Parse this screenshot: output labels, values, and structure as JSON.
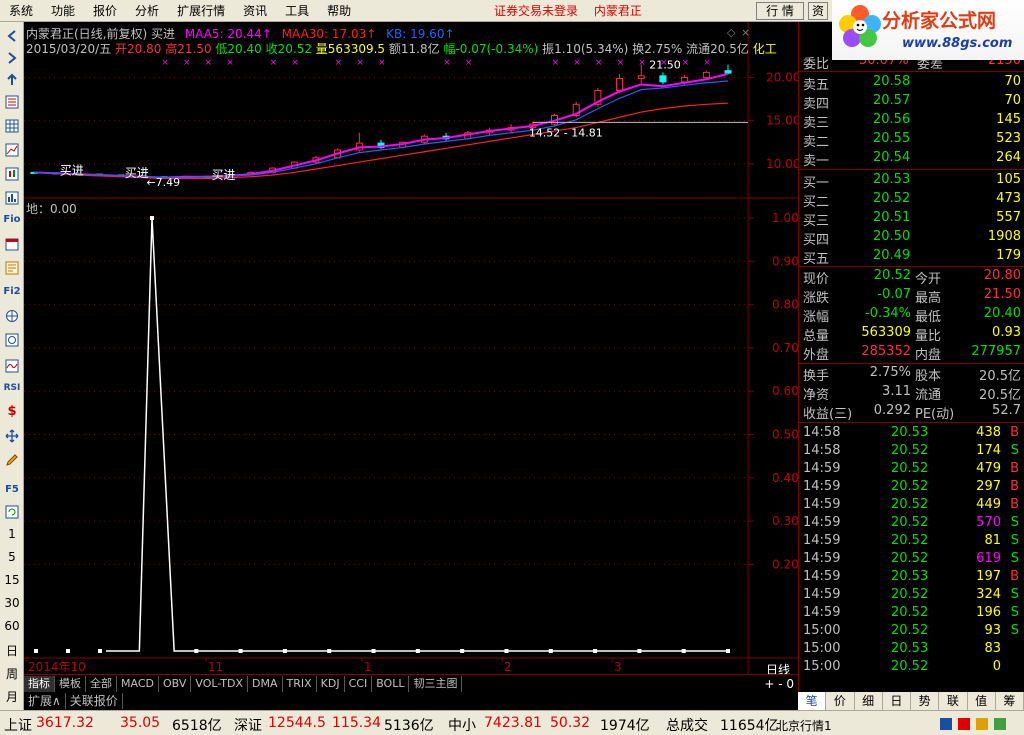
{
  "menu": {
    "items": [
      "系统",
      "功能",
      "报价",
      "分析",
      "扩展行情",
      "资讯",
      "工具",
      "帮助"
    ],
    "status_msg": "证券交易未登录",
    "stock_name": "内蒙君正",
    "btn_hangqing": "行 情",
    "btn_zi": "资"
  },
  "logo": {
    "title": "分析家公式网",
    "url": "www.88gs.com"
  },
  "chart_header": {
    "line1_title": "内蒙君正(日线,前复权) 买进",
    "ma5": "MAA5: 20.44↑",
    "ma30": "MAA30: 17.03↑",
    "kb": "KB: 19.60↑",
    "line2_date": "2015/03/20/五",
    "open": "开20.80",
    "high": "高21.50",
    "low": "低20.40",
    "close": "收20.52",
    "vol": "量563309.5",
    "amount": "额11.8亿",
    "change": "幅-0.07(-0.34%)",
    "amp": "振1.10(5.34%)",
    "turnover": "换2.75%",
    "float_cap": "流通20.5亿",
    "industry": "化工",
    "lower_title": "地：0.00"
  },
  "left_toolbar": {
    "labels": [
      "Fio",
      "Fi2",
      "RSI",
      "F5"
    ],
    "periods": [
      "1",
      "5",
      "15",
      "30",
      "60",
      "日",
      "周",
      "月"
    ]
  },
  "chart_tabs": {
    "items": [
      "指标",
      "模板",
      "全部",
      "MACD",
      "OBV",
      "VOL-TDX",
      "DMA",
      "TRIX",
      "KDJ",
      "CCI",
      "BOLL",
      "韧三主图"
    ],
    "right": "+ - 0",
    "period_label": "日线"
  },
  "ext_tabs": [
    "扩展∧",
    "关联报价"
  ],
  "chart_data": [
    {
      "type": "candlestick",
      "title": "",
      "y_ticks": [
        "20.00",
        "15.00",
        "10.00"
      ],
      "ylim": [
        6.5,
        22.5
      ],
      "annotations": [
        "买进",
        "买进",
        "买进",
        "7.49",
        "21.50",
        "14.52 - 14.81"
      ],
      "series": [
        {
          "name": "MAA5",
          "color": "#ff00ff",
          "values": [
            9.0,
            8.9,
            8.8,
            8.7,
            8.6,
            8.5,
            8.4,
            8.5,
            8.5,
            8.6,
            8.8,
            9.2,
            9.8,
            10.4,
            11.2,
            11.9,
            12.0,
            12.3,
            12.8,
            13.0,
            13.4,
            13.8,
            14.1,
            14.4,
            15.0,
            15.8,
            17.2,
            18.4,
            19.2,
            19.0,
            19.4,
            19.8,
            20.44
          ]
        },
        {
          "name": "MAA30",
          "color": "#ff2020",
          "values": [
            9.0,
            8.9,
            8.7,
            8.6,
            8.5,
            8.4,
            8.3,
            8.3,
            8.3,
            8.4,
            8.5,
            8.7,
            9.0,
            9.4,
            9.8,
            10.2,
            10.6,
            11.0,
            11.4,
            11.8,
            12.2,
            12.6,
            13.0,
            13.4,
            13.8,
            14.2,
            14.8,
            15.4,
            16.0,
            16.4,
            16.7,
            16.9,
            17.03
          ]
        },
        {
          "name": "KB",
          "color": "#1e64ff",
          "values": [
            9.0,
            8.9,
            8.8,
            8.7,
            8.6,
            8.5,
            8.4,
            8.4,
            8.5,
            8.6,
            8.7,
            9.0,
            9.5,
            10.0,
            10.7,
            11.3,
            11.6,
            11.9,
            12.3,
            12.6,
            12.9,
            13.3,
            13.6,
            13.9,
            14.4,
            15.1,
            16.4,
            17.6,
            18.6,
            18.8,
            19.1,
            19.4,
            19.6
          ]
        }
      ],
      "candles": [
        [
          9.0,
          9.1,
          8.9,
          8.95
        ],
        [
          8.95,
          9.0,
          8.85,
          8.9
        ],
        [
          8.9,
          8.95,
          8.75,
          8.8
        ],
        [
          8.8,
          8.85,
          8.65,
          8.7
        ],
        [
          8.7,
          8.75,
          8.55,
          8.6
        ],
        [
          8.6,
          8.7,
          8.45,
          8.5
        ],
        [
          8.5,
          8.55,
          8.3,
          8.4
        ],
        [
          8.4,
          8.6,
          8.35,
          8.55
        ],
        [
          8.55,
          8.6,
          8.45,
          8.5
        ],
        [
          8.5,
          8.8,
          8.45,
          8.7
        ],
        [
          8.7,
          9.1,
          8.65,
          9.0
        ],
        [
          9.0,
          9.6,
          8.95,
          9.5
        ],
        [
          9.5,
          10.3,
          9.4,
          10.2
        ],
        [
          10.2,
          10.9,
          10.0,
          10.7
        ],
        [
          10.7,
          11.8,
          10.6,
          11.6
        ],
        [
          11.6,
          13.6,
          11.4,
          12.4
        ],
        [
          12.4,
          12.8,
          11.7,
          11.9
        ],
        [
          11.9,
          12.6,
          11.8,
          12.5
        ],
        [
          12.5,
          13.4,
          12.3,
          13.2
        ],
        [
          13.2,
          13.6,
          12.7,
          12.9
        ],
        [
          12.9,
          13.8,
          12.8,
          13.6
        ],
        [
          13.6,
          14.2,
          13.2,
          13.9
        ],
        [
          13.9,
          14.6,
          13.5,
          14.2
        ],
        [
          14.2,
          14.9,
          13.8,
          14.6
        ],
        [
          14.6,
          15.8,
          14.4,
          15.6
        ],
        [
          15.6,
          17.2,
          15.4,
          16.9
        ],
        [
          16.9,
          18.8,
          16.6,
          18.5
        ],
        [
          18.5,
          20.4,
          18.2,
          19.9
        ],
        [
          19.9,
          21.5,
          19.3,
          20.2
        ],
        [
          20.2,
          20.6,
          19.2,
          19.5
        ],
        [
          19.5,
          20.3,
          19.1,
          20.0
        ],
        [
          20.0,
          20.8,
          19.7,
          20.6
        ],
        [
          20.8,
          21.5,
          20.4,
          20.52
        ]
      ]
    },
    {
      "type": "line",
      "title": "地：0.00",
      "y_ticks": [
        "1.00",
        "0.90",
        "0.80",
        "0.70",
        "0.60",
        "0.50",
        "0.40",
        "0.30",
        "0.20"
      ],
      "ylim": [
        0,
        1
      ],
      "x_ticks": [
        "2014年10",
        "11",
        "1",
        "2",
        "3"
      ],
      "values": [
        0,
        0,
        0,
        0,
        0,
        0,
        1.0,
        0,
        0,
        0,
        0,
        0,
        0,
        0,
        0,
        0,
        0,
        0,
        0,
        0,
        0,
        0,
        0,
        0,
        0,
        0,
        0,
        0,
        0,
        0,
        0,
        0,
        0
      ]
    }
  ],
  "order_book": {
    "wei_bi_label": "委比",
    "wei_bi": "50.07%",
    "wei_cha_label": "委差",
    "wei_cha": "2150",
    "sell": [
      {
        "label": "卖五",
        "price": "20.58",
        "vol": "70"
      },
      {
        "label": "卖四",
        "price": "20.57",
        "vol": "70"
      },
      {
        "label": "卖三",
        "price": "20.56",
        "vol": "145"
      },
      {
        "label": "卖二",
        "price": "20.55",
        "vol": "523"
      },
      {
        "label": "卖一",
        "price": "20.54",
        "vol": "264"
      }
    ],
    "buy": [
      {
        "label": "买一",
        "price": "20.53",
        "vol": "105"
      },
      {
        "label": "买二",
        "price": "20.52",
        "vol": "473"
      },
      {
        "label": "买三",
        "price": "20.51",
        "vol": "557"
      },
      {
        "label": "买四",
        "price": "20.50",
        "vol": "1908"
      },
      {
        "label": "买五",
        "price": "20.49",
        "vol": "179"
      }
    ]
  },
  "quote": [
    {
      "l1": "现价",
      "v1": "20.52",
      "l2": "今开",
      "v2": "20.80"
    },
    {
      "l1": "涨跌",
      "v1": "-0.07",
      "l2": "最高",
      "v2": "21.50"
    },
    {
      "l1": "涨幅",
      "v1": "-0.34%",
      "l2": "最低",
      "v2": "20.40"
    },
    {
      "l1": "总量",
      "v1": "563309",
      "l2": "量比",
      "v2": "0.93"
    },
    {
      "l1": "外盘",
      "v1": "285352",
      "l2": "内盘",
      "v2": "277957"
    }
  ],
  "fundamentals": [
    {
      "l1": "换手",
      "v1": "2.75%",
      "l2": "股本",
      "v2": "20.5亿"
    },
    {
      "l1": "净资",
      "v1": "3.11",
      "l2": "流通",
      "v2": "20.5亿"
    },
    {
      "l1": "收益(三)",
      "v1": "0.292",
      "l2": "PE(动)",
      "v2": "52.7"
    }
  ],
  "ticks": [
    {
      "time": "14:58",
      "price": "20.53",
      "vol": "438",
      "side": "B"
    },
    {
      "time": "14:58",
      "price": "20.52",
      "vol": "174",
      "side": "S"
    },
    {
      "time": "14:59",
      "price": "20.52",
      "vol": "479",
      "side": "B"
    },
    {
      "time": "14:59",
      "price": "20.52",
      "vol": "297",
      "side": "B"
    },
    {
      "time": "14:59",
      "price": "20.52",
      "vol": "449",
      "side": "B"
    },
    {
      "time": "14:59",
      "price": "20.52",
      "vol": "570",
      "side": "S"
    },
    {
      "time": "14:59",
      "price": "20.52",
      "vol": "81",
      "side": "S"
    },
    {
      "time": "14:59",
      "price": "20.52",
      "vol": "619",
      "side": "S"
    },
    {
      "time": "14:59",
      "price": "20.53",
      "vol": "197",
      "side": "B"
    },
    {
      "time": "14:59",
      "price": "20.52",
      "vol": "324",
      "side": "S"
    },
    {
      "time": "14:59",
      "price": "20.52",
      "vol": "196",
      "side": "S"
    },
    {
      "time": "15:00",
      "price": "20.52",
      "vol": "93",
      "side": "S"
    },
    {
      "time": "15:00",
      "price": "20.53",
      "vol": "83",
      "side": ""
    },
    {
      "time": "15:00",
      "price": "20.52",
      "vol": "0",
      "side": ""
    }
  ],
  "right_tabs": [
    "笔",
    "价",
    "细",
    "日",
    "势",
    "联",
    "值",
    "筹"
  ],
  "status": {
    "sh_label": "上证",
    "sh_val": "3617.32",
    "sh_chg": "35.05",
    "sh_amt": "6518亿",
    "sz_label": "深证",
    "sz_val": "12544.5",
    "sz_chg": "115.34",
    "sz_amt": "5136亿",
    "zx_label": "中小",
    "zx_val": "7423.81",
    "zx_chg": "50.32",
    "zx_amt": "1974亿",
    "total_label": "总成交",
    "total_val": "11654亿",
    "bj_label": "北京行情1"
  },
  "colors": {
    "up": "#ff3030",
    "down": "#00e000",
    "vol": "#ffff00",
    "label": "#c0c0c0",
    "ma5": "#ff00ff",
    "ma30": "#ff2020",
    "kb": "#1e64ff"
  }
}
